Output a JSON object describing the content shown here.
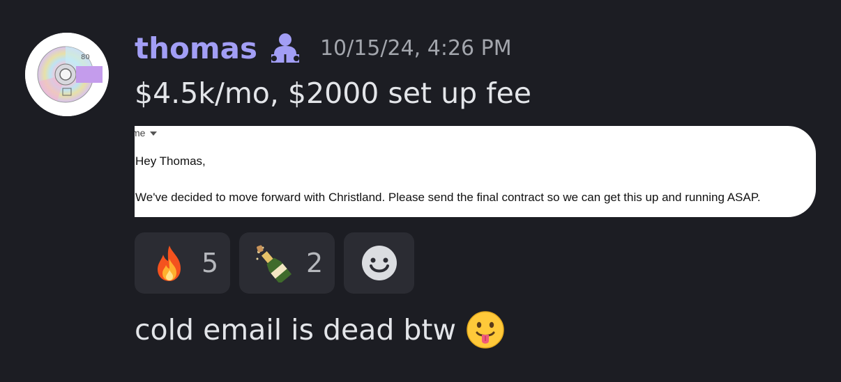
{
  "message": {
    "username": "thomas",
    "timestamp": "10/15/24, 4:26 PM",
    "line1": "$4.5k/mo, $2000 set up fee",
    "line2": "cold email is dead btw",
    "avatar_label": "80"
  },
  "email_screenshot": {
    "recipient": "me",
    "greeting": "Hey Thomas,",
    "body": "We've decided to move forward with Christland. Please send the final contract so we can get this up and running ASAP."
  },
  "reactions": [
    {
      "emoji": "fire",
      "count": "5"
    },
    {
      "emoji": "bottle-with-popping-cork",
      "count": "2"
    },
    {
      "emoji": "add-reaction-smiley"
    }
  ],
  "icons": {
    "role": "person-reading-icon",
    "trailing_emoji": "face-with-tongue"
  },
  "colors": {
    "background": "#1c1d23",
    "username": "#a29ef5",
    "timestamp": "#a3a6ad",
    "text": "#e3e5e9",
    "reaction_bg": "#2b2c33"
  }
}
